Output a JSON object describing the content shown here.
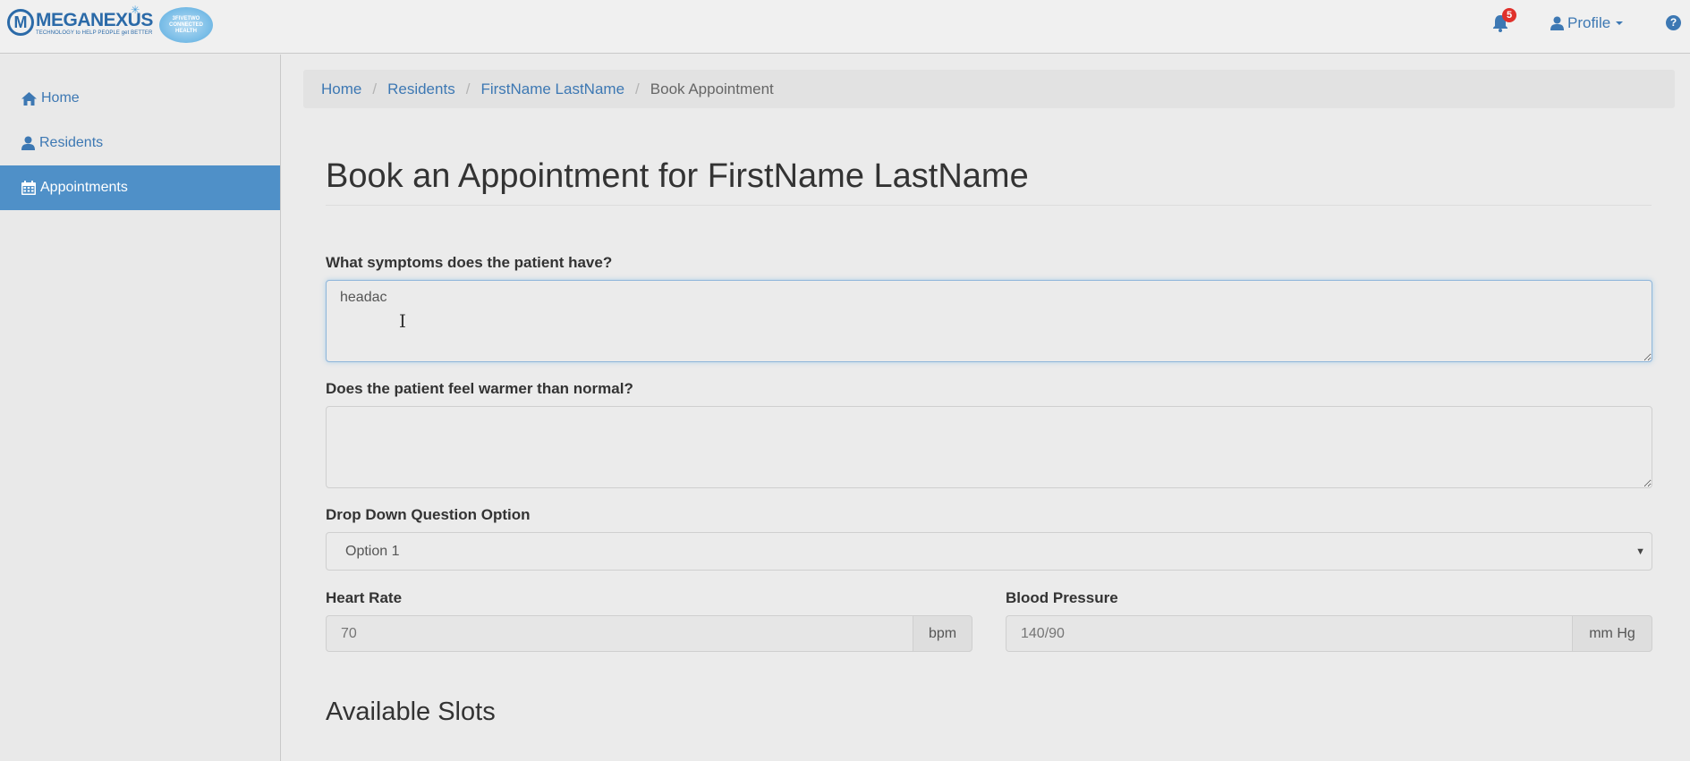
{
  "brand": {
    "name": "MEGANEXUS",
    "tagline": "TECHNOLOGY to HELP PEOPLE get BETTER",
    "partner_lines": [
      "3FIVETWO",
      "CONNECTED",
      "HEALTH"
    ]
  },
  "navbar": {
    "notifications_count": "5",
    "profile_label": "Profile",
    "help_symbol": "?"
  },
  "sidebar": {
    "items": [
      {
        "label": "Home",
        "icon": "home-icon",
        "active": false
      },
      {
        "label": "Residents",
        "icon": "user-icon",
        "active": false
      },
      {
        "label": "Appointments",
        "icon": "calendar-icon",
        "active": true
      }
    ]
  },
  "breadcrumb": {
    "items": [
      "Home",
      "Residents",
      "FirstName LastName",
      "Book Appointment"
    ],
    "separator": "/"
  },
  "page": {
    "title": "Book an Appointment for FirstName LastName"
  },
  "form": {
    "symptoms_label": "What symptoms does the patient have?",
    "symptoms_value": "headac",
    "warmer_label": "Does the patient feel warmer than normal?",
    "warmer_value": "",
    "dropdown_label": "Drop Down Question Option",
    "dropdown_value": "Option 1",
    "heart_rate_label": "Heart Rate",
    "heart_rate_placeholder": "70",
    "heart_rate_unit": "bpm",
    "blood_pressure_label": "Blood Pressure",
    "blood_pressure_placeholder": "140/90",
    "blood_pressure_unit": "mm Hg"
  },
  "slots": {
    "title": "Available Slots"
  },
  "colors": {
    "accent": "#3d78b3",
    "active_nav": "#4f90c8",
    "badge": "#e0312b"
  }
}
